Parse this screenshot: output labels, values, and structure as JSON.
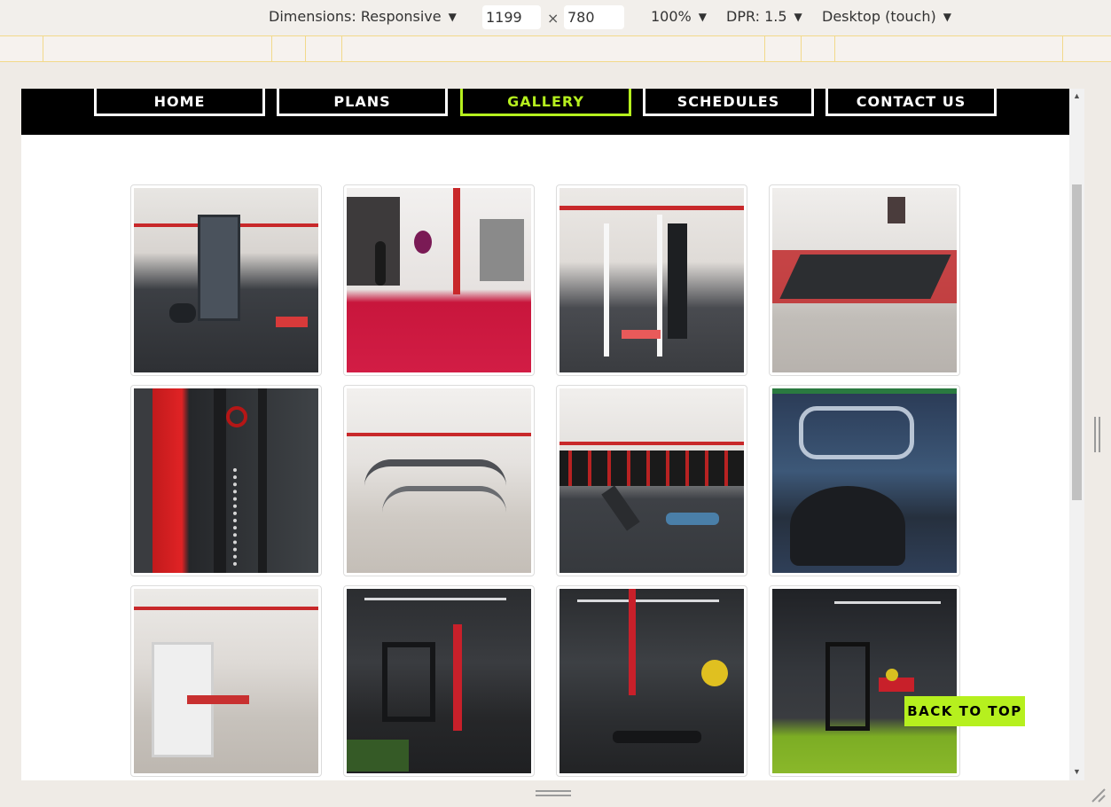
{
  "toolbar": {
    "dimensions_label": "Dimensions: Responsive",
    "width": "1199",
    "height": "780",
    "times": "×",
    "zoom": "100%",
    "dpr": "DPR: 1.5",
    "device_mode": "Desktop (touch)"
  },
  "nav": {
    "items": [
      {
        "label": "HOME"
      },
      {
        "label": "PLANS"
      },
      {
        "label": "GALLERY"
      },
      {
        "label": "SCHEDULES"
      },
      {
        "label": "CONTACT US"
      }
    ],
    "active": "GALLERY",
    "accent_color": "#b6f01e"
  },
  "gallery": {
    "photos": [
      {
        "name": "cable-machine-floor"
      },
      {
        "name": "boxing-room-red-floor"
      },
      {
        "name": "white-weight-machines"
      },
      {
        "name": "treadmill-row"
      },
      {
        "name": "red-rack-chains"
      },
      {
        "name": "cross-trainer-row"
      },
      {
        "name": "dumbbell-rack"
      },
      {
        "name": "graffiti-elliptical"
      },
      {
        "name": "white-machines-wood-floor"
      },
      {
        "name": "dark-gym-red-machines"
      },
      {
        "name": "therapy-room-benches"
      },
      {
        "name": "dark-gym-green-turf"
      }
    ]
  },
  "back_to_top": "BACK TO TOP",
  "icons": {
    "caret": "caret-down-icon",
    "scroll_up": "scroll-up-arrow-icon",
    "scroll_down": "scroll-down-arrow-icon",
    "resize": "resize-handle-icon"
  }
}
